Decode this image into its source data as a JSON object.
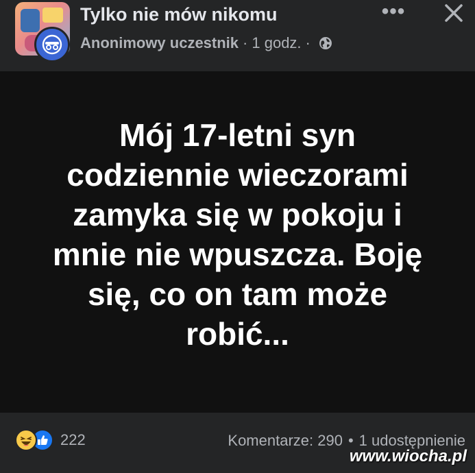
{
  "header": {
    "group_name": "Tylko nie mów nikomu",
    "author": "Anonimowy uczestnik",
    "separator": "·",
    "time": "1 godz.",
    "more_label": "•••",
    "icons": {
      "privacy": "globe-icon",
      "close": "close-icon",
      "author_avatar": "anonymous-member-icon"
    }
  },
  "post": {
    "text": "Mój 17-letni syn\ncodziennie wieczorami\nzamyka się w pokoju i\nmnie nie wpuszcza. Boję\nsię, co on tam może\nrobić..."
  },
  "footer": {
    "reaction_count": "222",
    "comments": "Komentarze: 290",
    "dot": "•",
    "shares": "1 udostępnienie",
    "reaction_icons": [
      "haha-icon",
      "like-icon"
    ]
  },
  "watermark": "www.wiocha.pl",
  "colors": {
    "header_bg": "#242526",
    "post_bg": "#111111",
    "accent": "#1877f2",
    "text_primary": "#e4e6eb",
    "text_secondary": "#b0b3b8"
  }
}
